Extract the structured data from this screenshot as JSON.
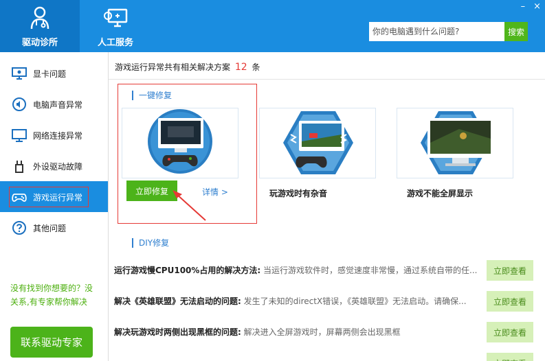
{
  "header": {
    "tabs": [
      {
        "label": "驱动诊所",
        "icon": "stethoscope-icon"
      },
      {
        "label": "人工服务",
        "icon": "support-monitor-icon"
      }
    ],
    "search": {
      "placeholder": "你的电脑遇到什么问题?",
      "button_label": "搜索"
    },
    "window_controls": [
      "–",
      "×"
    ]
  },
  "sidebar": {
    "items": [
      {
        "label": "显卡问题",
        "icon": "display-card-icon"
      },
      {
        "label": "电脑声音异常",
        "icon": "speaker-icon"
      },
      {
        "label": "网络连接异常",
        "icon": "monitor-network-icon"
      },
      {
        "label": "外设驱动故障",
        "icon": "usb-plug-icon"
      },
      {
        "label": "游戏运行异常",
        "icon": "gamepad-icon"
      },
      {
        "label": "其他问题",
        "icon": "question-icon"
      }
    ],
    "help_text": "没有找到你想要的？没关系,有专家帮你解决",
    "contact_label": "联系驱动专家"
  },
  "main": {
    "summary_prefix": "游戏运行异常共有相关解决方案",
    "summary_count": "12",
    "summary_suffix": "条",
    "one_click_title": "一键修复",
    "diy_title": "DIY修复",
    "fix_button": "立即修复",
    "detail_link": "详情 >",
    "cards": [
      {
        "title": ""
      },
      {
        "title": "玩游戏时有杂音"
      },
      {
        "title": "游戏不能全屏显示"
      }
    ],
    "solutions": [
      {
        "title": "运行游戏慢CPU100%占用的解决方法:",
        "desc": "当运行游戏软件时，感觉速度非常慢，通过系统自带的任...",
        "button": "立即查看"
      },
      {
        "title": "解决《英雄联盟》无法启动的问题:",
        "desc": "发生了未知的directX错误，《英雄联盟》无法启动。请确保...",
        "button": "立即查看"
      },
      {
        "title": "解决玩游戏时两侧出现黑框的问题:",
        "desc": "解决进入全屏游戏时，屏幕两侧会出现黑框",
        "button": "立即查看"
      },
      {
        "title": "",
        "desc": "",
        "button": "立即查看"
      }
    ]
  },
  "colors": {
    "primary": "#1a8de0",
    "green": "#4cb31a",
    "red": "#e53935"
  }
}
